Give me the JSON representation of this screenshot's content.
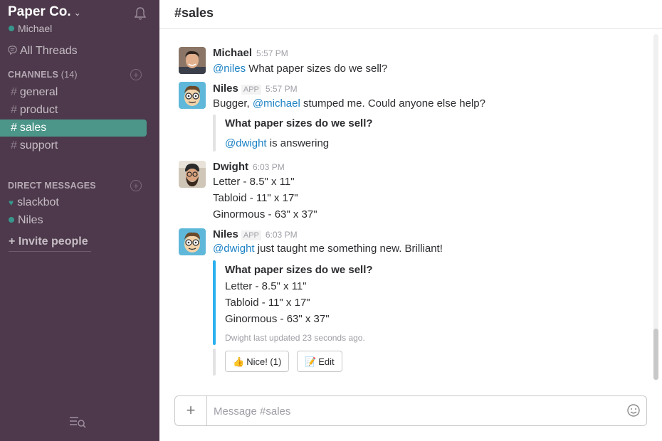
{
  "sidebar": {
    "team_name": "Paper Co.",
    "team_caret": "⌄",
    "user_name": "Michael",
    "all_threads": "All Threads",
    "channels_label": "CHANNELS",
    "channels_count": "(14)",
    "channels": [
      {
        "hash": "#",
        "name": "general"
      },
      {
        "hash": "#",
        "name": "product"
      },
      {
        "hash": "#",
        "name": "sales"
      },
      {
        "hash": "#",
        "name": "support"
      }
    ],
    "active_channel": "sales",
    "dm_label": "DIRECT MESSAGES",
    "dms": [
      {
        "name": "slackbot",
        "icon": "heart-icon"
      },
      {
        "name": "Niles",
        "icon": "presence-dot"
      }
    ],
    "invite": "+ Invite people"
  },
  "header": {
    "channel_title": "#sales"
  },
  "messages": [
    {
      "author": "Michael",
      "time": "5:57 PM",
      "mention": "@niles",
      "text": " What paper sizes do we sell?"
    },
    {
      "author": "Niles",
      "badge": "APP",
      "time": "5:57 PM",
      "pre": "Bugger, ",
      "mention": "@michael",
      "text": " stumped me. Could anyone else help?",
      "quote_title": "What paper sizes do we sell?",
      "quote_mention": "@dwight",
      "quote_text": " is answering"
    },
    {
      "author": "Dwight",
      "time": "6:03 PM",
      "lines": [
        "Letter - 8.5\" x 11\"",
        "Tabloid - 11\" x 17\"",
        "Ginormous - 63\" x 37\""
      ]
    },
    {
      "author": "Niles",
      "badge": "APP",
      "time": "6:03 PM",
      "mention": "@dwight",
      "text": " just taught me something new. Brilliant!",
      "quote_title": "What paper sizes do we sell?",
      "quote_lines": [
        "Letter - 8.5\" x 11\"",
        "Tabloid - 11\" x 17\"",
        "Ginormous - 63\" x 37\""
      ],
      "quote_footer": "Dwight last updated 23 seconds ago.",
      "buttons": [
        {
          "emoji": "👍",
          "label": "Nice! (1)"
        },
        {
          "emoji": "📝",
          "label": "Edit"
        }
      ]
    }
  ],
  "composer": {
    "placeholder": "Message #sales"
  },
  "colors": {
    "sidebar": "#4d394b",
    "active_channel": "#4c9689",
    "mention": "#1d82c4",
    "quote_active": "#2ab0ec"
  }
}
